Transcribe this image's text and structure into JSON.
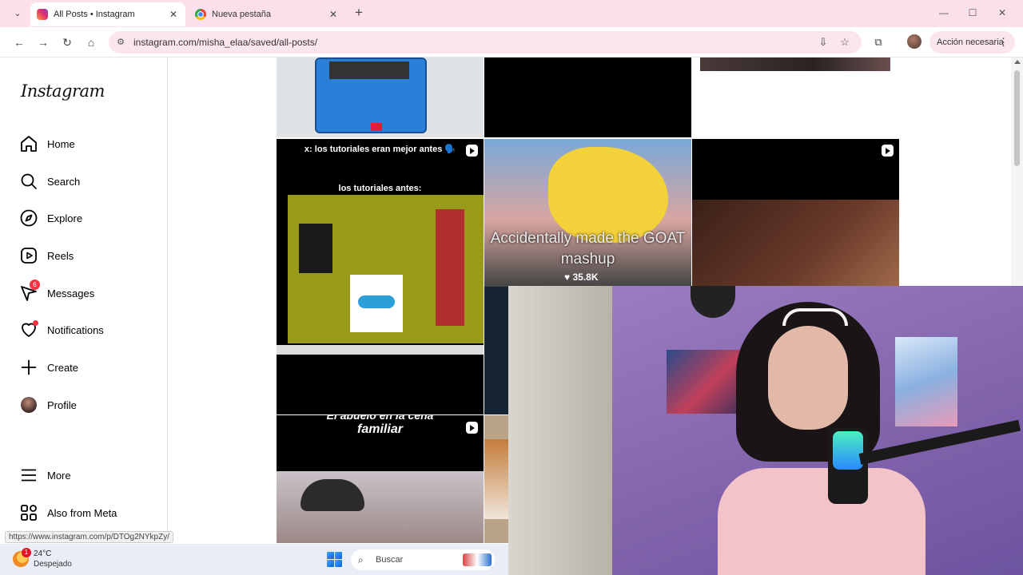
{
  "browser": {
    "tabs": [
      {
        "title": "All Posts • Instagram",
        "active": true
      },
      {
        "title": "Nueva pestaña",
        "active": false
      }
    ],
    "url": "instagram.com/misha_elaa/saved/all-posts/",
    "action_label": "Acción necesaria",
    "status_url": "https://www.instagram.com/p/DTOg2NYkpZy/"
  },
  "sidebar": {
    "logo": "Instagram",
    "items": [
      {
        "label": "Home",
        "icon": "home-icon"
      },
      {
        "label": "Search",
        "icon": "search-icon"
      },
      {
        "label": "Explore",
        "icon": "compass-icon"
      },
      {
        "label": "Reels",
        "icon": "reels-icon"
      },
      {
        "label": "Messages",
        "icon": "messenger-icon",
        "badge": "6"
      },
      {
        "label": "Notifications",
        "icon": "heart-icon"
      },
      {
        "label": "Create",
        "icon": "plus-icon"
      },
      {
        "label": "Profile",
        "icon": "profile-avatar"
      },
      {
        "label": "More",
        "icon": "menu-icon"
      },
      {
        "label": "Also from Meta",
        "icon": "meta-grid-icon"
      }
    ]
  },
  "posts": {
    "tutorial_caption_1": "x: los tutoriales eran mejor antes 🗣️",
    "tutorial_caption_2": "los tutoriales antes:",
    "mashup_caption": "Accidentally made the GOAT mashup",
    "mashup_likes": "35.8K",
    "family_caption": "familiar",
    "family_caption_partial": "El abuelo en la cena"
  },
  "taskbar": {
    "temperature": "24°C",
    "weather": "Despejado",
    "weather_badge": "1",
    "search_placeholder": "Buscar"
  }
}
